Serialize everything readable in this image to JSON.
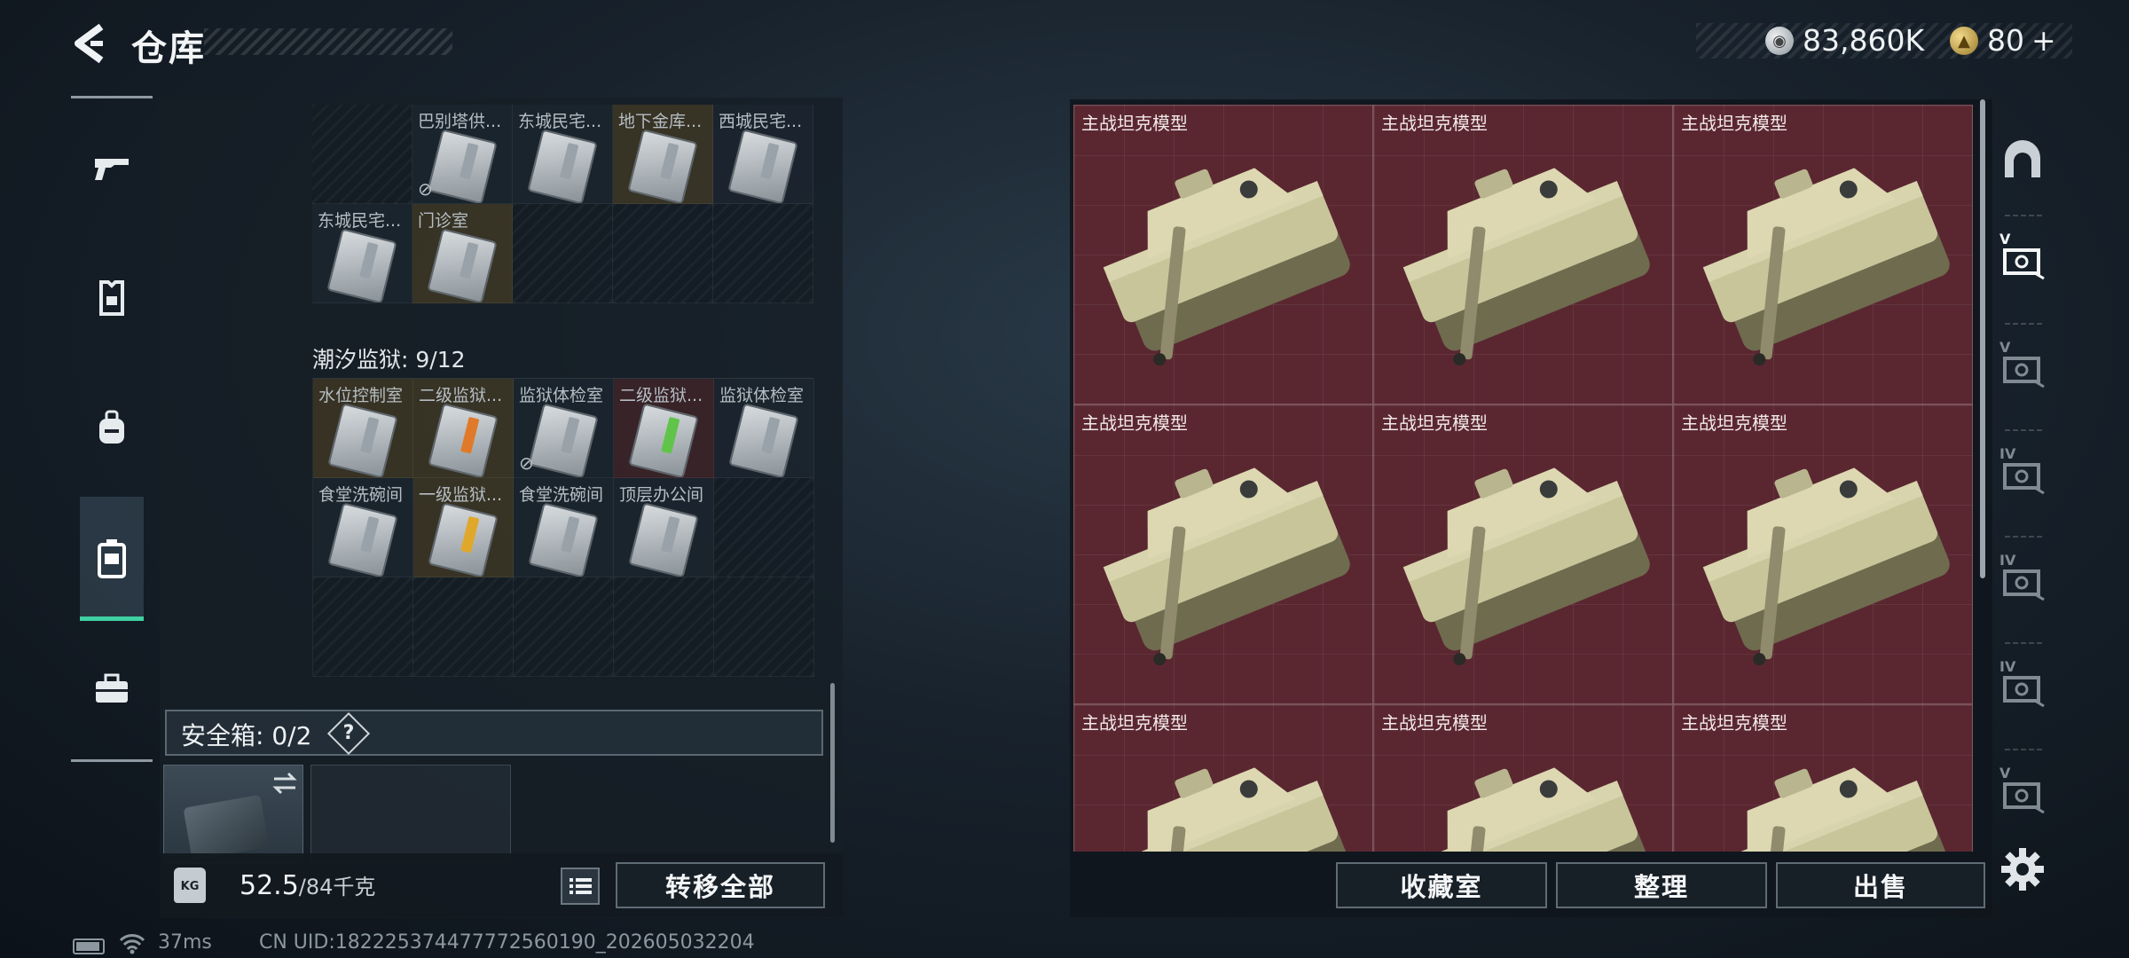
{
  "header": {
    "title": "仓库"
  },
  "currency": {
    "silver": "83,860K",
    "gold": "80",
    "gold_plus": "+"
  },
  "warehouse": {
    "top_rows": [
      [
        {
          "label": "",
          "type": "empty"
        },
        {
          "label": "巴别塔供...",
          "type": "card",
          "disabled": true
        },
        {
          "label": "东城民宅...",
          "type": "card"
        },
        {
          "label": "地下金库...",
          "type": "card",
          "tone": "gold"
        },
        {
          "label": "西城民宅...",
          "type": "card"
        }
      ],
      [
        {
          "label": "东城民宅...",
          "type": "card"
        },
        {
          "label": "门诊室",
          "type": "card",
          "tone": "gold"
        },
        {
          "label": "",
          "type": "empty"
        },
        {
          "label": "",
          "type": "empty"
        },
        {
          "label": "",
          "type": "empty"
        }
      ]
    ],
    "section_label": "潮汐监狱: 9/12",
    "section_rows": [
      [
        {
          "label": "水位控制室",
          "type": "card",
          "tone": "gold"
        },
        {
          "label": "二级监狱...",
          "type": "card",
          "tone": "gold",
          "stripe": "#e07a2a"
        },
        {
          "label": "监狱体检室",
          "type": "card",
          "disabled": true
        },
        {
          "label": "二级监狱...",
          "type": "card",
          "tone": "red",
          "stripe": "#61c44a"
        },
        {
          "label": "监狱体检室",
          "type": "card"
        }
      ],
      [
        {
          "label": "食堂洗碗间",
          "type": "card"
        },
        {
          "label": "一级监狱...",
          "type": "card",
          "tone": "gold",
          "stripe": "#e0a82a"
        },
        {
          "label": "食堂洗碗间",
          "type": "card"
        },
        {
          "label": "顶层办公间",
          "type": "card"
        },
        {
          "label": "",
          "type": "empty"
        }
      ],
      [
        {
          "label": "",
          "type": "empty"
        },
        {
          "label": "",
          "type": "empty"
        },
        {
          "label": "",
          "type": "empty"
        },
        {
          "label": "",
          "type": "empty"
        },
        {
          "label": "",
          "type": "empty"
        }
      ]
    ]
  },
  "safe_box": {
    "label": "安全箱: 0/2",
    "help": "?"
  },
  "weight": {
    "current": "52.5",
    "max": "/84千克",
    "icon_text": "KG"
  },
  "buttons": {
    "transfer_all": "转移全部",
    "collection_room": "收藏室",
    "organize": "整理",
    "sell": "出售"
  },
  "items": [
    {
      "label": "主战坦克模型"
    },
    {
      "label": "主战坦克模型"
    },
    {
      "label": "主战坦克模型"
    },
    {
      "label": "主战坦克模型"
    },
    {
      "label": "主战坦克模型"
    },
    {
      "label": "主战坦克模型"
    },
    {
      "label": "主战坦克模型"
    },
    {
      "label": "主战坦克模型"
    },
    {
      "label": "主战坦克模型"
    }
  ],
  "right_nav": [
    "V",
    "V",
    "IV",
    "IV",
    "IV",
    "V"
  ],
  "status": {
    "ping": "37ms",
    "uid": "CN UID:1822253744777725601​90_202605032204"
  },
  "colors": {
    "accent": "#3fd1a2",
    "item_bg": "#5a2731",
    "gold_tone": "#5f4b23",
    "red_tone": "#5f2828"
  }
}
